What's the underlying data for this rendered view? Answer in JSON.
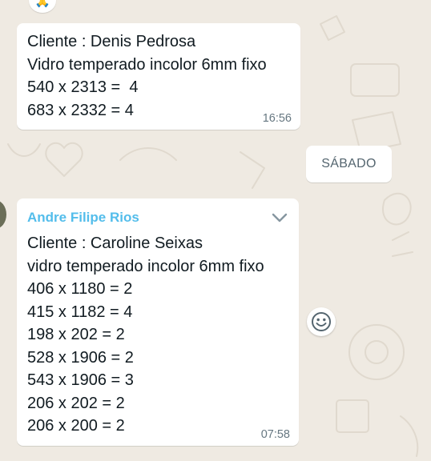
{
  "top_reaction": {
    "emoji": "🙏"
  },
  "messages": [
    {
      "lines": [
        "Cliente : Denis Pedrosa",
        "Vidro temperado incolor 6mm fixo",
        "540 x 2313 =  4",
        "683 x 2332 = 4"
      ],
      "time": "16:56"
    },
    {
      "sender": "Andre Filipe Rios",
      "sender_color": "#53bdeb",
      "lines": [
        "Cliente : Caroline Seixas",
        "vidro temperado incolor 6mm fixo",
        "406 x 1180 = 2",
        "415 x 1182 = 4",
        "198 x 202 = 2",
        "528 x 1906 = 2",
        "543 x 1906 = 3",
        "206 x 202 = 2",
        "206 x 200 = 2"
      ],
      "time": "07:58"
    }
  ],
  "date_divider": "SÁBADO",
  "icons": {
    "menu": "chevron-down-icon",
    "react": "emoji-smile-icon"
  },
  "colors": {
    "chat_background": "#efeae2",
    "bubble": "#ffffff",
    "timestamp": "#667781"
  }
}
